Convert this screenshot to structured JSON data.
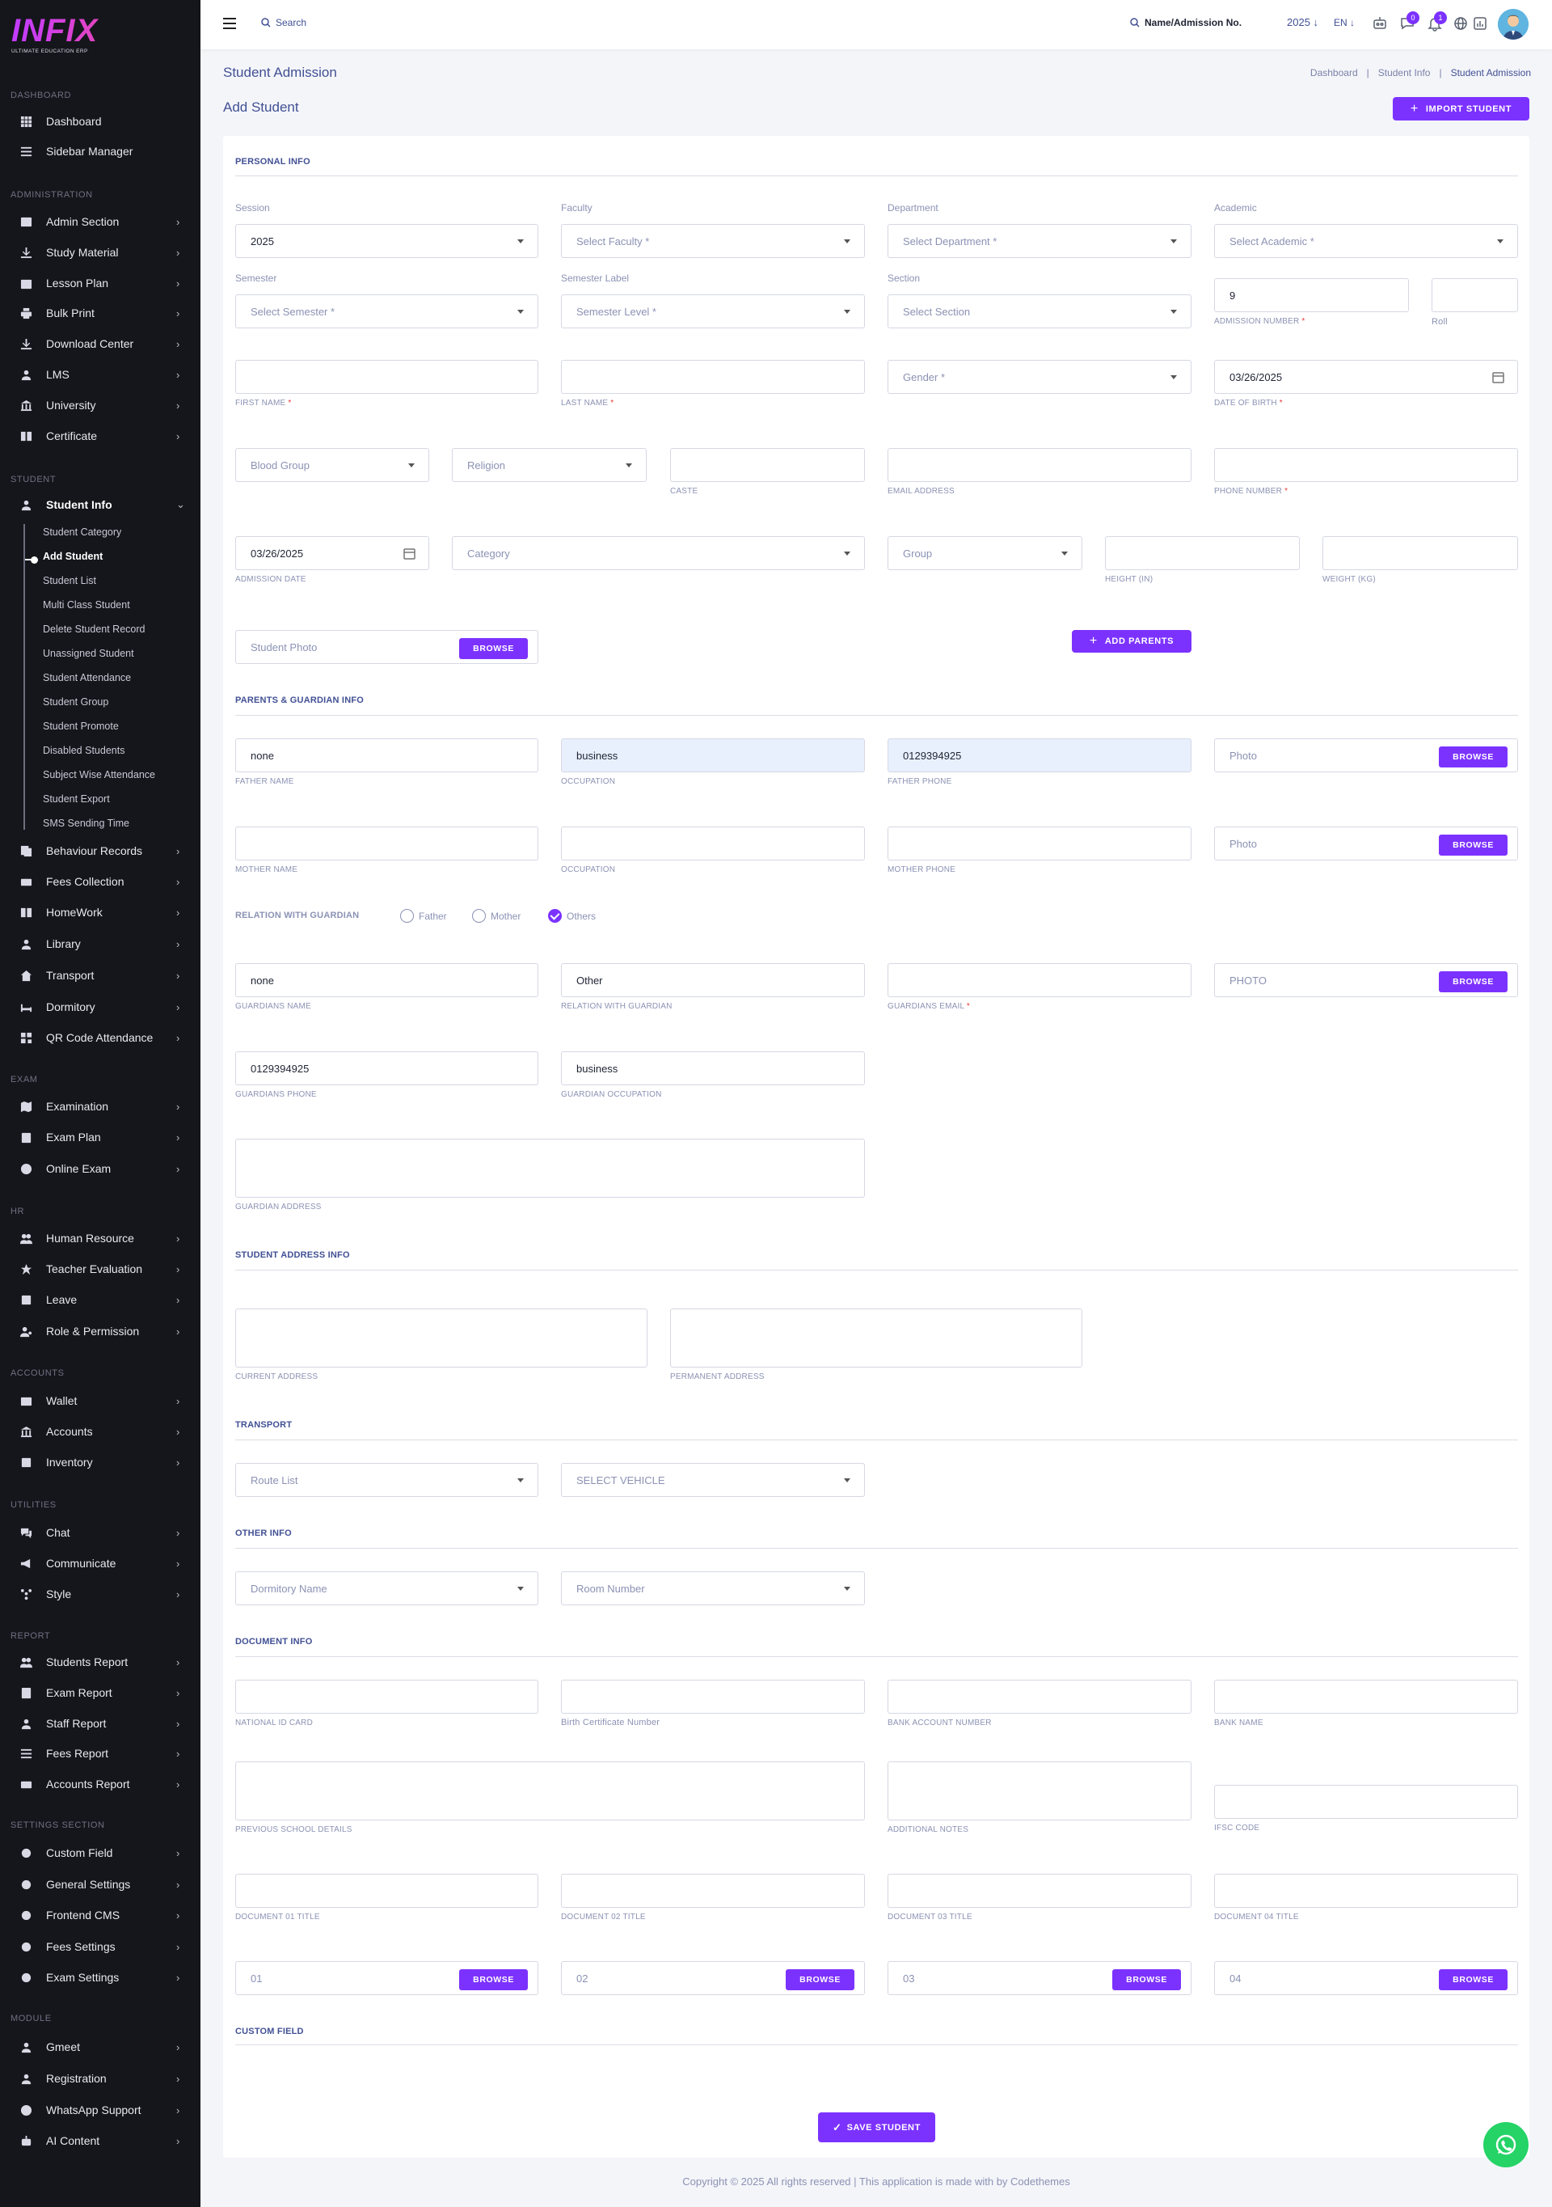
{
  "brand": {
    "name": "INFIX",
    "tagline": "ULTIMATE EDUCATION ERP"
  },
  "sidebar": {
    "sections": {
      "dashboard": "DASHBOARD",
      "administration": "ADMINISTRATION",
      "student": "STUDENT",
      "exam": "EXAM",
      "hr": "HR",
      "accounts": "ACCOUNTS",
      "utilities": "UTILITIES",
      "report": "REPORT",
      "settings": "SETTINGS SECTION",
      "module": "MODULE"
    },
    "items": {
      "dashboard": "Dashboard",
      "sidebar_manager": "Sidebar Manager",
      "admin_section": "Admin Section",
      "study_material": "Study Material",
      "lesson_plan": "Lesson Plan",
      "bulk_print": "Bulk Print",
      "download_center": "Download Center",
      "lms": "LMS",
      "university": "University",
      "certificate": "Certificate",
      "student_info": "Student Info",
      "behaviour_records": "Behaviour Records",
      "fees_collection": "Fees Collection",
      "homework": "HomeWork",
      "library": "Library",
      "transport": "Transport",
      "dormitory": "Dormitory",
      "qr_code_attendance": "QR Code Attendance",
      "examination": "Examination",
      "exam_plan": "Exam Plan",
      "online_exam": "Online Exam",
      "human_resource": "Human Resource",
      "teacher_evaluation": "Teacher Evaluation",
      "leave": "Leave",
      "role_permission": "Role & Permission",
      "wallet": "Wallet",
      "accounts": "Accounts",
      "inventory": "Inventory",
      "chat": "Chat",
      "communicate": "Communicate",
      "style": "Style",
      "students_report": "Students Report",
      "exam_report": "Exam Report",
      "staff_report": "Staff Report",
      "fees_report": "Fees Report",
      "accounts_report": "Accounts Report",
      "custom_field": "Custom Field",
      "general_settings": "General Settings",
      "frontend_cms": "Frontend CMS",
      "fees_settings": "Fees Settings",
      "exam_settings": "Exam Settings",
      "gmeet": "Gmeet",
      "registration": "Registration",
      "whatsapp_support": "WhatsApp Support",
      "ai_content": "AI Content"
    },
    "student_sub": [
      "Student Category",
      "Add Student",
      "Student List",
      "Multi Class Student",
      "Delete Student Record",
      "Unassigned Student",
      "Student Attendance",
      "Student Group",
      "Student Promote",
      "Disabled Students",
      "Subject Wise Attendance",
      "Student Export",
      "SMS Sending Time"
    ]
  },
  "topbar": {
    "search": "Search",
    "search2": "Name/Admission No.",
    "year": "2025",
    "lang": "EN",
    "chat_count": "0",
    "notif_count": "1"
  },
  "page": {
    "title": "Student Admission",
    "breadcrumb": [
      "Dashboard",
      "Student Info",
      "Student Admission"
    ],
    "subtitle": "Add Student",
    "import_btn": "IMPORT STUDENT",
    "add_parents_btn": "ADD PARENTS",
    "save_btn": "SAVE STUDENT",
    "browse": "BROWSE"
  },
  "sections": {
    "personal": "PERSONAL INFO",
    "parents": "PARENTS & GUARDIAN INFO",
    "address": "STUDENT ADDRESS INFO",
    "transport": "TRANSPORT",
    "other": "OTHER INFO",
    "document": "DOCUMENT INFO",
    "custom": "CUSTOM FIELD"
  },
  "personal": {
    "session_label": "Session",
    "session_value": "2025",
    "faculty_label": "Faculty",
    "faculty_value": "Select Faculty *",
    "department_label": "Department",
    "department_value": "Select Department *",
    "academic_label": "Academic",
    "academic_value": "Select Academic *",
    "semester_label": "Semester",
    "semester_value": "Select Semester *",
    "semester_level_label": "Semester Label",
    "semester_level_value": "Semester Level *",
    "section_label": "Section",
    "section_value": "Select Section",
    "admission_no_value": "9",
    "admission_no_label": "ADMISSION NUMBER",
    "roll_label": "Roll",
    "first_name_label": "FIRST NAME",
    "last_name_label": "LAST NAME",
    "gender_value": "Gender *",
    "dob_value": "03/26/2025",
    "dob_label": "DATE OF BIRTH",
    "blood_group_value": "Blood Group",
    "religion_value": "Religion",
    "caste_label": "CASTE",
    "email_label": "EMAIL ADDRESS",
    "phone_label": "PHONE NUMBER",
    "admission_date_value": "03/26/2025",
    "admission_date_label": "ADMISSION DATE",
    "category_value": "Category",
    "group_value": "Group",
    "height_label": "HEIGHT (IN)",
    "weight_label": "WEIGHT (KG)",
    "photo_placeholder": "Student Photo",
    "required_mark": "*"
  },
  "parents": {
    "father_name_value": "none",
    "father_name_label": "FATHER NAME",
    "father_occ_value": "business",
    "occupation_label": "OCCUPATION",
    "father_phone_value": "0129394925",
    "father_phone_label": "FATHER PHONE",
    "photo_placeholder": "Photo",
    "mother_name_label": "MOTHER NAME",
    "mother_phone_label": "MOTHER PHONE",
    "relation_heading": "RELATION WITH GUARDIAN",
    "radio_father": "Father",
    "radio_mother": "Mother",
    "radio_others": "Others",
    "guardian_name_value": "none",
    "guardian_name_label": "GUARDIANS NAME",
    "guardian_relation_value": "Other",
    "guardian_relation_label": "RELATION WITH GUARDIAN",
    "guardian_email_label": "GUARDIANS EMAIL",
    "guardian_photo_placeholder": "PHOTO",
    "guardian_phone_value": "0129394925",
    "guardian_phone_label": "GUARDIANS PHONE",
    "guardian_occ_value": "business",
    "guardian_occ_label": "GUARDIAN OCCUPATION",
    "guardian_address_label": "GUARDIAN ADDRESS"
  },
  "address": {
    "current": "CURRENT ADDRESS",
    "permanent": "PERMANENT ADDRESS"
  },
  "transport": {
    "route": "Route List",
    "vehicle": "SELECT VEHICLE"
  },
  "other": {
    "dormitory": "Dormitory Name",
    "room": "Room Number"
  },
  "document": {
    "national_id": "NATIONAL ID CARD",
    "birth_cert": "Birth Certificate Number",
    "bank_account": "BANK ACCOUNT NUMBER",
    "bank_name": "BANK NAME",
    "prev_school": "PREVIOUS SCHOOL DETAILS",
    "notes": "ADDITIONAL NOTES",
    "ifsc": "IFSC CODE",
    "doc1_title": "DOCUMENT 01 TITLE",
    "doc2_title": "DOCUMENT 02 TITLE",
    "doc3_title": "DOCUMENT 03 TITLE",
    "doc4_title": "DOCUMENT 04 TITLE",
    "file1": "01",
    "file2": "02",
    "file3": "03",
    "file4": "04"
  },
  "footer": {
    "text": "Copyright © 2025 All rights reserved | This application is made with by Codethemes"
  },
  "colors": {
    "accent": "#7c32ff",
    "sidebar_bg": "#15161b",
    "text": "#415094"
  }
}
